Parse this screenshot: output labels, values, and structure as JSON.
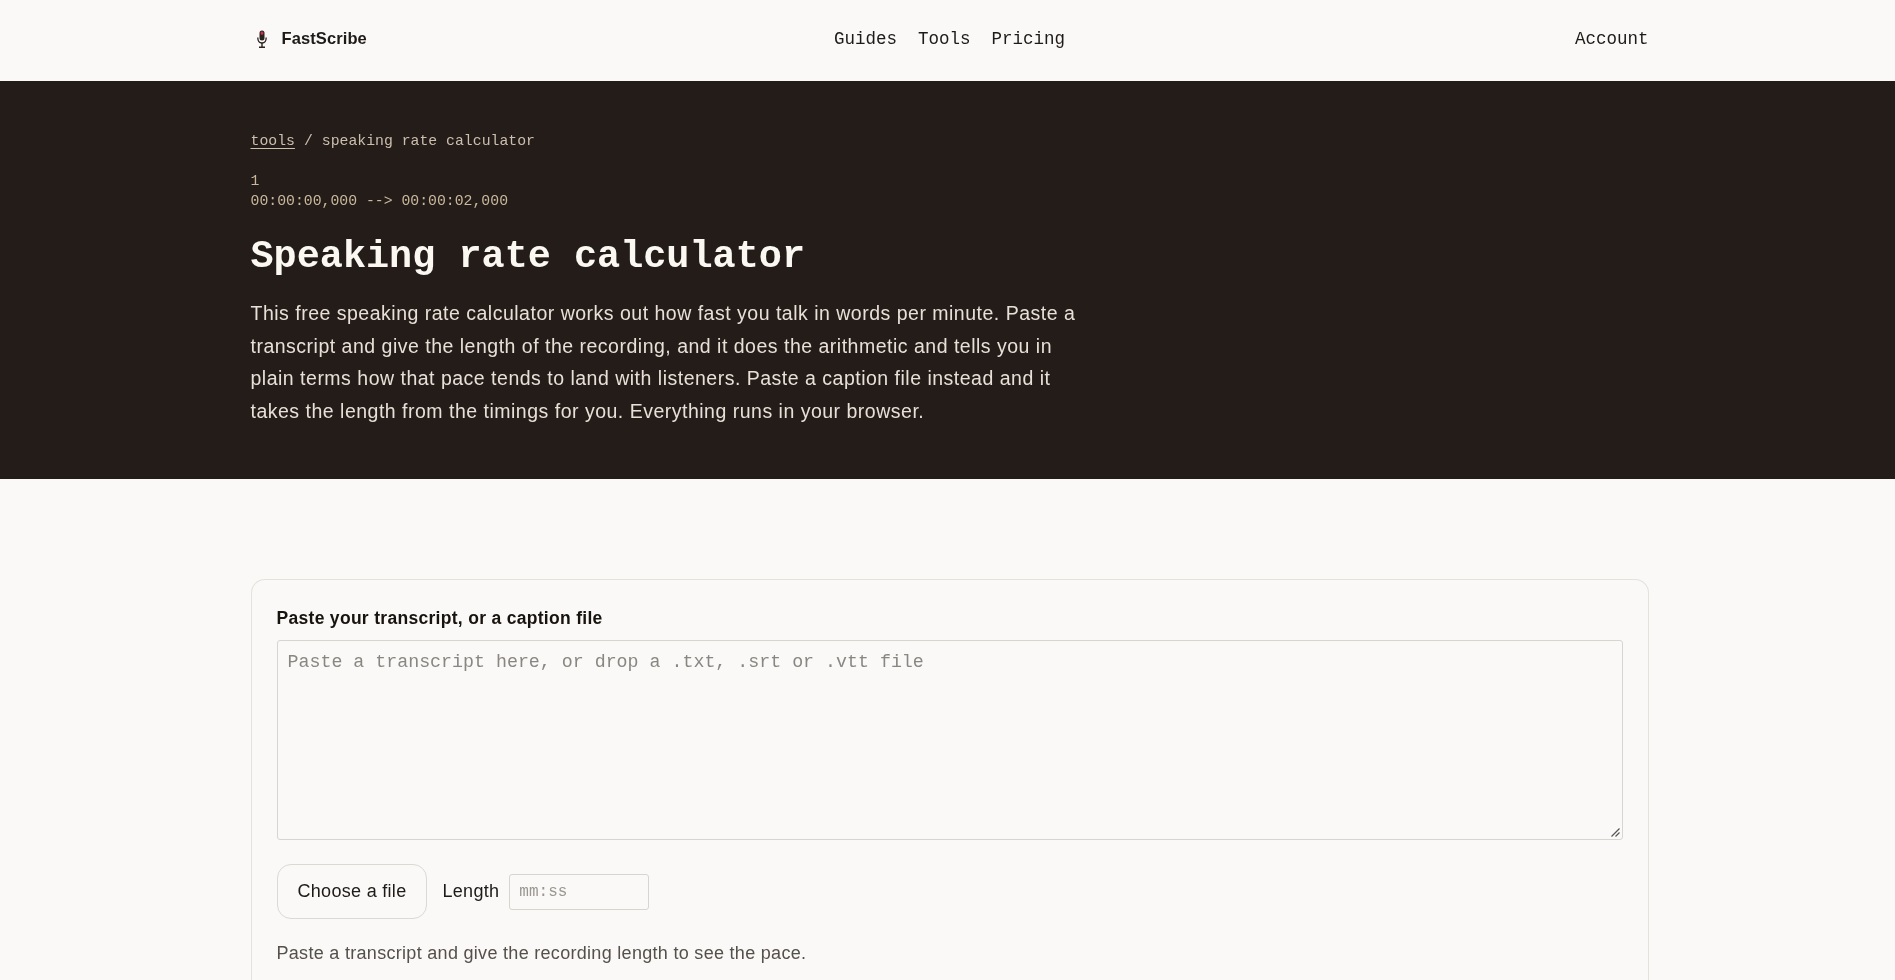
{
  "header": {
    "logo": "FastScribe",
    "nav": [
      "Guides",
      "Tools",
      "Pricing"
    ],
    "account": "Account"
  },
  "hero": {
    "breadcrumb": [
      {
        "label": "tools",
        "kind": "link"
      },
      {
        "label": "speaking rate calculator",
        "kind": "current"
      }
    ],
    "separator": "/",
    "caption_lines": [
      "1",
      "00:00:00,000 --> 00:00:02,000"
    ],
    "title": "Speaking rate calculator",
    "description": "This free speaking rate calculator works out how fast you talk in words per minute. Paste a transcript and give the length of the recording, and it does the arithmetic and tells you in plain terms how that pace tends to land with listeners. Paste a caption file instead and it takes the length from the timings for you. Everything runs in your browser."
  },
  "tool": {
    "transcript": {
      "label": "Paste your transcript, or a caption file",
      "placeholder": "Paste a transcript here, or drop a .txt, .srt or .vtt file"
    },
    "file_button": "Choose a file",
    "length": {
      "label": "Length",
      "placeholder": "mm:ss"
    },
    "hint": "Paste a transcript and give the recording length to see the pace."
  }
}
